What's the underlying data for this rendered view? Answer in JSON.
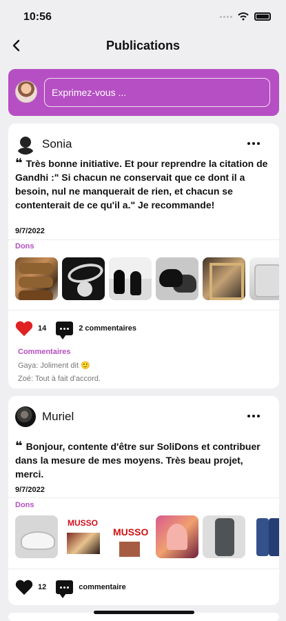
{
  "status": {
    "time": "10:56"
  },
  "nav": {
    "title": "Publications"
  },
  "composer": {
    "placeholder": "Exprimez-vous ..."
  },
  "posts": [
    {
      "author": "Sonia",
      "text": "Très bonne initiative. Et pour reprendre la citation de Gandhi :\" Si chacun ne conservait que ce dont il a besoin, nul ne manquerait de rien, et chacun se contenterait de ce qu'il a.\" Je recommande!",
      "date": "9/7/2022",
      "section": "Dons",
      "likes": "14",
      "comments_label": "2 commentaires",
      "comments_title": "Commentaires",
      "comments": [
        "Gaya: Joliment dit 🙂",
        "Zoé: Tout à fait d'accord."
      ]
    },
    {
      "author": "Muriel",
      "text": "Bonjour, contente d'être sur SoliDons et contribuer dans la mesure de mes moyens. Très beau projet, merci.",
      "date": "9/7/2022",
      "section": "Dons",
      "likes": "12",
      "comments_label": "commentaire"
    }
  ],
  "icons": {
    "back": "chevron-left-icon",
    "more": "more-icon",
    "like": "heart-icon",
    "comment": "comment-icon"
  },
  "colors": {
    "accent": "#b54fc3",
    "like": "#e02222"
  }
}
